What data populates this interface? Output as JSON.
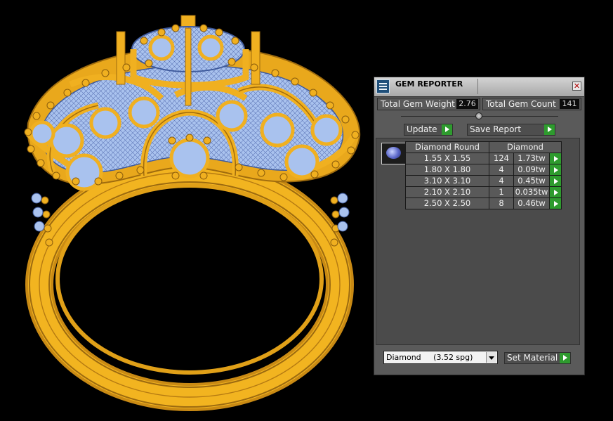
{
  "viewport": {
    "subject": "3D ring model with gem settings"
  },
  "panel": {
    "title": "GEM REPORTER",
    "close_label": "✕",
    "total_gem_weight_label": "Total Gem Weight",
    "total_gem_weight_value": "2.76",
    "total_gem_count_label": "Total Gem Count",
    "total_gem_count_value": "141",
    "update_label": "Update",
    "save_report_label": "Save Report",
    "table": {
      "header_shape": "Diamond Round",
      "header_material": "Diamond",
      "rows": [
        {
          "size": "1.55 X 1.55",
          "count": "124",
          "weight": "1.73tw"
        },
        {
          "size": "1.80 X 1.80",
          "count": "4",
          "weight": "0.09tw"
        },
        {
          "size": "3.10 X 3.10",
          "count": "4",
          "weight": "0.45tw"
        },
        {
          "size": "2.10 X 2.10",
          "count": "1",
          "weight": "0.035tw"
        },
        {
          "size": "2.50 X 2.50",
          "count": "8",
          "weight": "0.46tw"
        }
      ]
    },
    "material_select": {
      "name": "Diamond",
      "spg": "(3.52 spg)"
    },
    "set_material_label": "Set Material"
  },
  "colors": {
    "gold": "#f0b020",
    "gem_fill": "#a9c2ee",
    "panel_bg": "#5a5a5a",
    "arrow_green": "#2e9b2e"
  }
}
